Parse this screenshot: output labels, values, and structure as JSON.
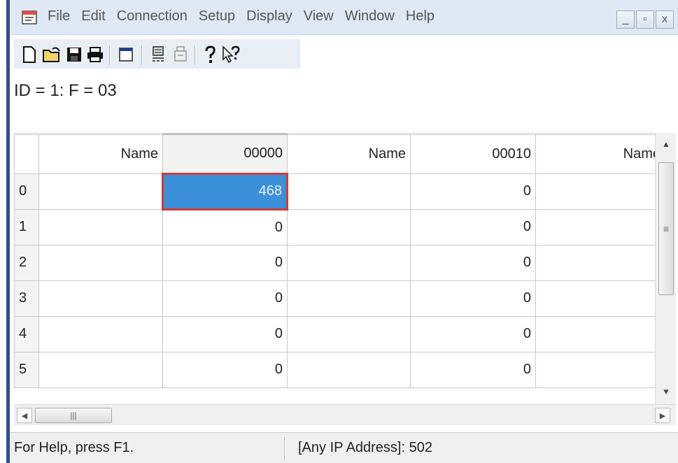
{
  "menubar": {
    "items": [
      "File",
      "Edit",
      "Connection",
      "Setup",
      "Display",
      "View",
      "Window",
      "Help"
    ]
  },
  "window_controls": {
    "minimize": "_",
    "restore": "▫",
    "close": "x"
  },
  "toolbar": {
    "buttons": [
      "new-document-icon",
      "open-folder-icon",
      "save-disk-icon",
      "print-icon",
      "window-icon",
      "connect-icon",
      "disconnect-icon",
      "help-icon",
      "context-help-icon"
    ]
  },
  "id_line": "ID = 1: F = 03",
  "grid": {
    "headers": [
      "Name",
      "00000",
      "Name",
      "00010",
      "Name"
    ],
    "rows": [
      {
        "num": "0",
        "c1": "",
        "c2": "468",
        "c3": "",
        "c4": "0",
        "c5": ""
      },
      {
        "num": "1",
        "c1": "",
        "c2": "0",
        "c3": "",
        "c4": "0",
        "c5": ""
      },
      {
        "num": "2",
        "c1": "",
        "c2": "0",
        "c3": "",
        "c4": "0",
        "c5": ""
      },
      {
        "num": "3",
        "c1": "",
        "c2": "0",
        "c3": "",
        "c4": "0",
        "c5": ""
      },
      {
        "num": "4",
        "c1": "",
        "c2": "0",
        "c3": "",
        "c4": "0",
        "c5": ""
      },
      {
        "num": "5",
        "c1": "",
        "c2": "0",
        "c3": "",
        "c4": "0",
        "c5": ""
      }
    ],
    "selected_color": "#3c8fd9",
    "selection_border": "#d23a3a"
  },
  "statusbar": {
    "help_text": "For Help, press F1.",
    "address_text": "[Any IP Address]: 502"
  }
}
